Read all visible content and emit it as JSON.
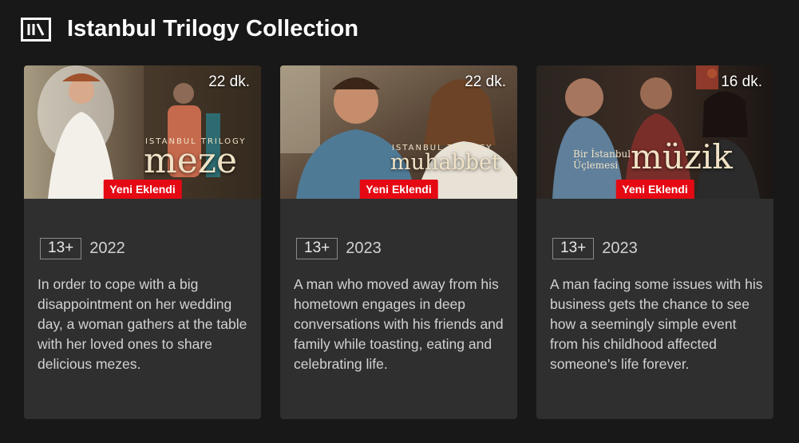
{
  "header": {
    "title": "Istanbul Trilogy Collection",
    "icon": "collection-icon"
  },
  "colors": {
    "background": "#181818",
    "card": "#2f2f2f",
    "badge": "#e50914"
  },
  "cards": [
    {
      "duration": "22 dk.",
      "badge": "Yeni Eklendi",
      "logo_sub": "ISTANBUL TRILOGY",
      "logo": "meze",
      "rating": "13+",
      "year": "2022",
      "description": "In order to cope with a big disappointment on her wedding day, a woman gathers at the table with her loved ones to share delicious mezes."
    },
    {
      "duration": "22 dk.",
      "badge": "Yeni Eklendi",
      "logo_sub": "ISTANBUL TRILOGY",
      "logo": "muhabbet",
      "rating": "13+",
      "year": "2023",
      "description": "A man who moved away from his hometown engages in deep conversations with his friends and family while toasting, eating and celebrating life."
    },
    {
      "duration": "16 dk.",
      "badge": "Yeni Eklendi",
      "logo_sub": "Bir İstanbul Üçlemesi",
      "logo": "müzik",
      "rating": "13+",
      "year": "2023",
      "description": "A man facing some issues with his business gets the chance to see how a seemingly simple event from his childhood affected someone's life forever."
    }
  ]
}
